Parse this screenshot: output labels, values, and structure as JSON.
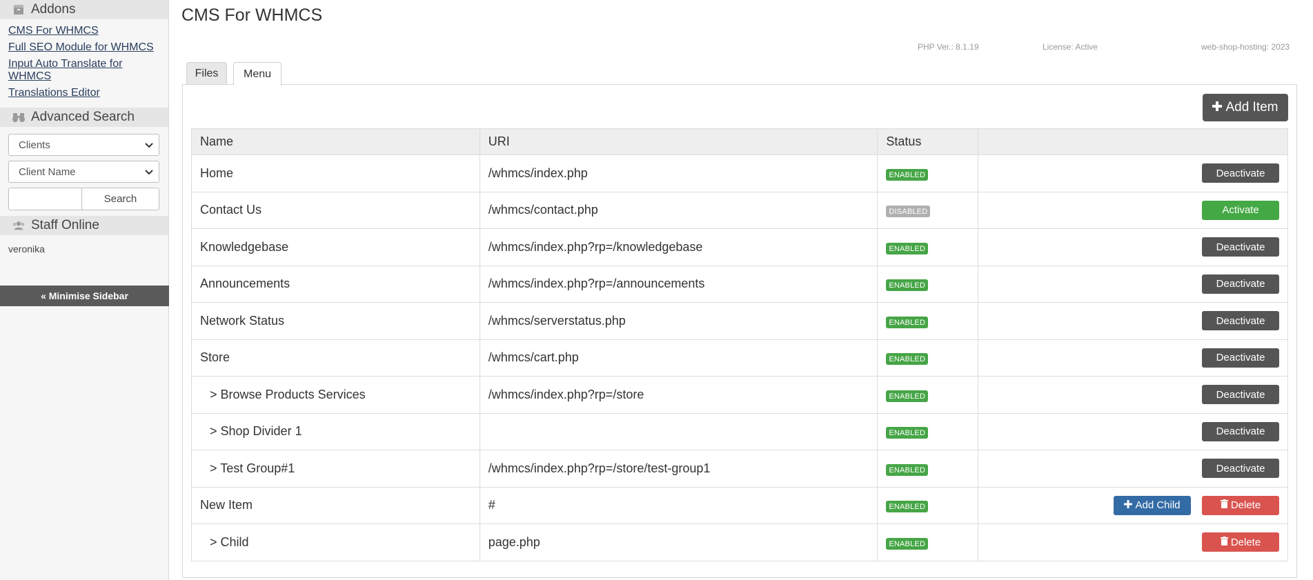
{
  "sidebar": {
    "addons_title": "Addons",
    "addons_links": [
      "CMS For WHMCS",
      "Full SEO Module for WHMCS",
      "Input Auto Translate for WHMCS",
      "Translations Editor"
    ],
    "advanced_search_title": "Advanced Search",
    "search_scope": "Clients",
    "search_field": "Client Name",
    "search_value": "",
    "search_button": "Search",
    "staff_online_title": "Staff Online",
    "staff_online_user": "veronika",
    "minimise_label": "« Minimise Sidebar"
  },
  "main": {
    "page_title": "CMS For WHMCS",
    "php_version": "PHP Ver.: 8.1.19",
    "license": "License: Active",
    "copyright": "web-shop-hosting: 2023",
    "tabs": [
      "Files",
      "Menu"
    ],
    "active_tab": "Menu",
    "add_item_label": "Add Item",
    "table": {
      "headers": [
        "Name",
        "URI",
        "Status",
        ""
      ],
      "rows": [
        {
          "name": "Home",
          "uri": "/whmcs/index.php",
          "status": "ENABLED",
          "action": "Deactivate"
        },
        {
          "name": "Contact Us",
          "uri": "/whmcs/contact.php",
          "status": "DISABLED",
          "action": "Activate"
        },
        {
          "name": "Knowledgebase",
          "uri": "/whmcs/index.php?rp=/knowledgebase",
          "status": "ENABLED",
          "action": "Deactivate"
        },
        {
          "name": "Announcements",
          "uri": "/whmcs/index.php?rp=/announcements",
          "status": "ENABLED",
          "action": "Deactivate"
        },
        {
          "name": "Network Status",
          "uri": "/whmcs/serverstatus.php",
          "status": "ENABLED",
          "action": "Deactivate"
        },
        {
          "name": "Store",
          "uri": "/whmcs/cart.php",
          "status": "ENABLED",
          "action": "Deactivate"
        },
        {
          "name": "> Browse Products Services",
          "uri": "/whmcs/index.php?rp=/store",
          "status": "ENABLED",
          "action": "Deactivate"
        },
        {
          "name": "> Shop Divider 1",
          "uri": "",
          "status": "ENABLED",
          "action": "Deactivate"
        },
        {
          "name": "> Test Group#1",
          "uri": "/whmcs/index.php?rp=/store/test-group1",
          "status": "ENABLED",
          "action": "Deactivate"
        },
        {
          "name": "New Item",
          "uri": "#",
          "status": "ENABLED",
          "add_child": "Add Child",
          "action": "Delete"
        },
        {
          "name": "> Child",
          "uri": "page.php",
          "status": "ENABLED",
          "action": "Delete"
        }
      ]
    }
  },
  "colors": {
    "enabled_badge": "#46a546",
    "disabled_badge": "#b0b0b0",
    "deactivate_button": "#555555",
    "activate_button": "#44a844",
    "delete_button": "#d9534f",
    "add_child_button": "#336ba5"
  }
}
